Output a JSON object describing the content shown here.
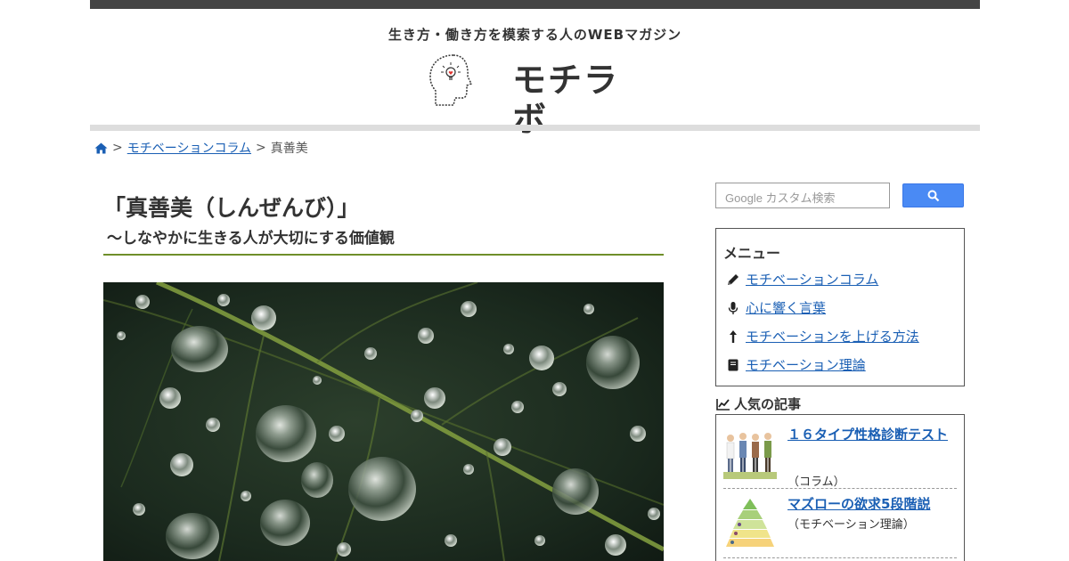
{
  "header": {
    "tagline": "生き方・働き方を模索する人のWEBマガジン",
    "logo_text": "モチラボ"
  },
  "breadcrumb": {
    "home_icon": "home-icon",
    "separator": ">",
    "parent_label": "モチベーションコラム",
    "current_label": "真善美"
  },
  "article": {
    "title": "「真善美（しんぜんび）」",
    "subtitle": "〜しなやかに生きる人が大切にする価値観"
  },
  "search": {
    "placeholder": "Google カスタム検索",
    "button_icon": "search-icon"
  },
  "menu": {
    "title": "メニュー",
    "items": [
      {
        "label": "モチベーションコラム",
        "icon": "pencil-icon"
      },
      {
        "label": "心に響く言葉",
        "icon": "microphone-icon"
      },
      {
        "label": "モチベーションを上げる方法",
        "icon": "arrow-up-icon"
      },
      {
        "label": "モチベーション理論",
        "icon": "book-icon"
      }
    ]
  },
  "popular": {
    "title": "人気の記事",
    "icon": "line-chart-icon",
    "items": [
      {
        "title": "１６タイプ性格診断テスト",
        "category": "（コラム）"
      },
      {
        "title": "マズローの欲求5段階説",
        "category": "（モチベーション理論）"
      }
    ]
  },
  "colors": {
    "top_bar": "#444444",
    "link": "#1a5fb4",
    "title_rule": "#6f8f2a",
    "search_button": "#4a8af4"
  }
}
